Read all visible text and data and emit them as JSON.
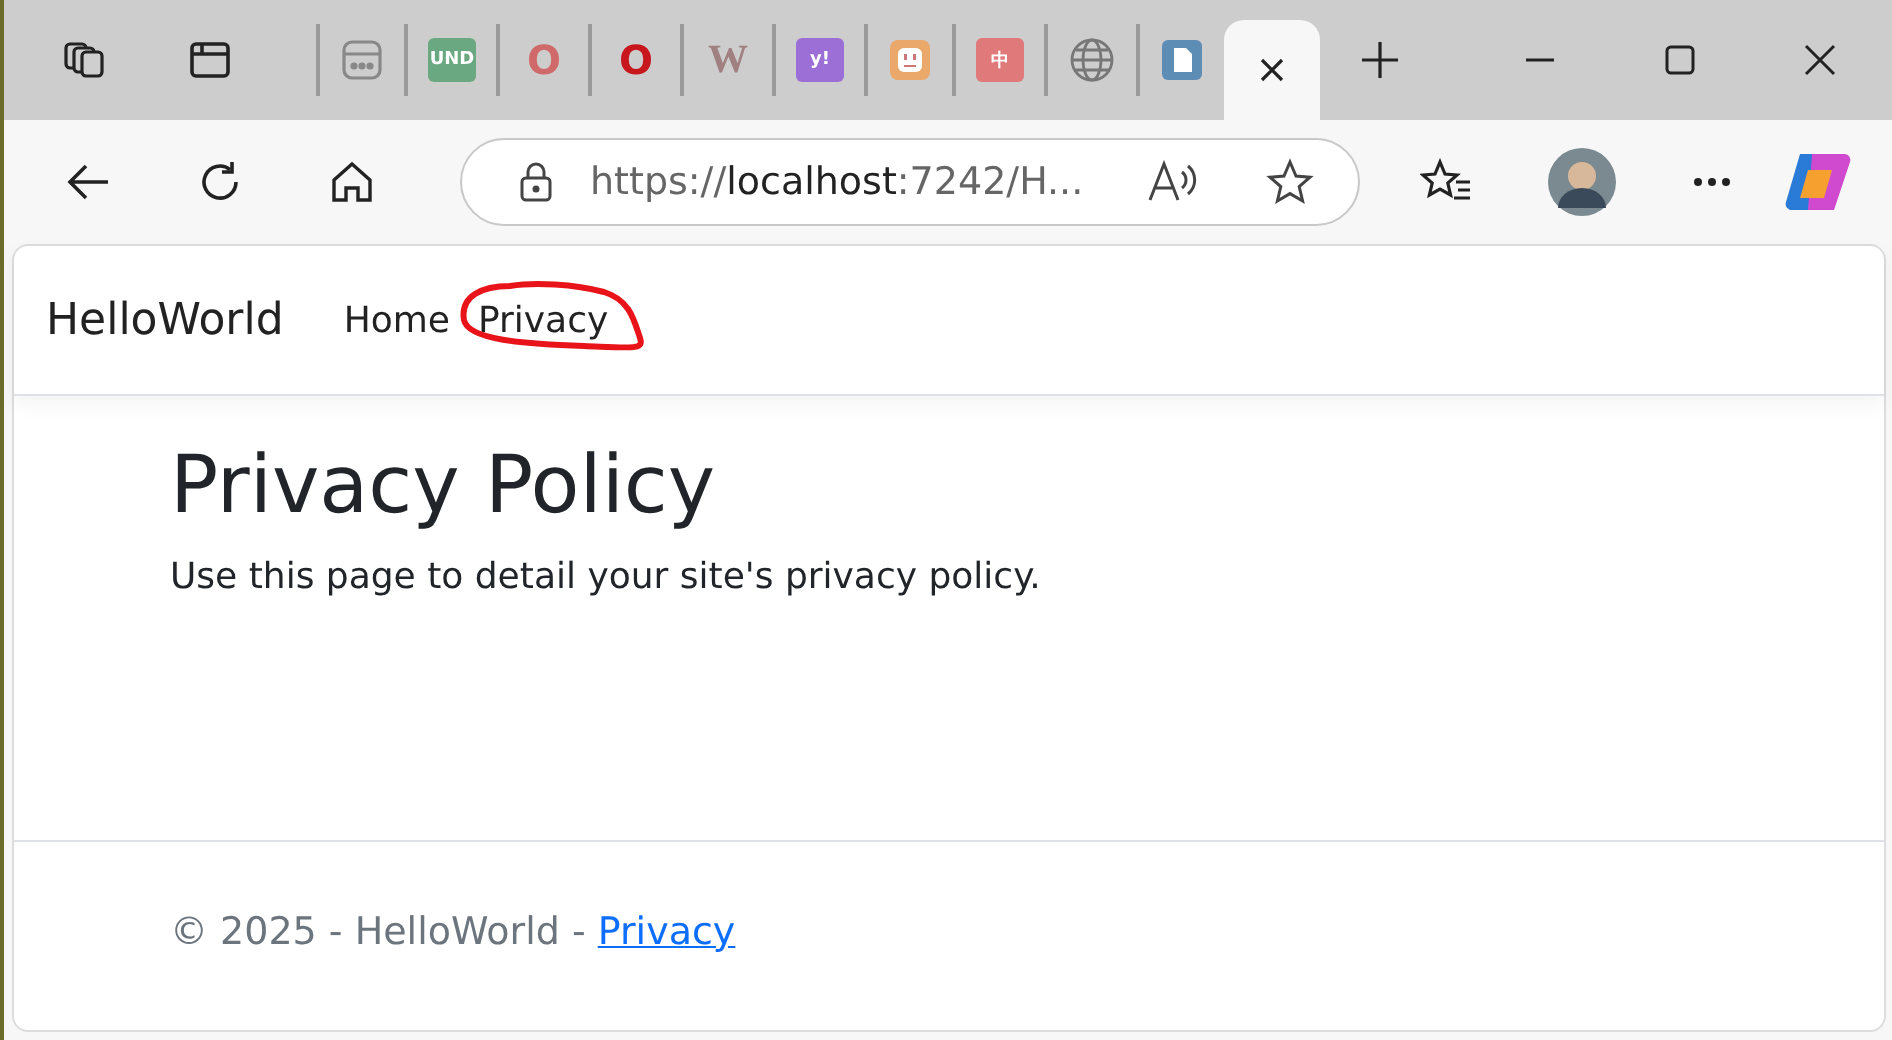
{
  "tabs": [
    {
      "kind": "grid",
      "selected": false
    },
    {
      "kind": "badge",
      "glyph": "UND",
      "color": "#6aa881",
      "selected": false
    },
    {
      "kind": "ring",
      "glyph": "O",
      "color": "#d06a6a",
      "selected": false
    },
    {
      "kind": "ring",
      "glyph": "O",
      "color": "#c8161d",
      "selected": false
    },
    {
      "kind": "letter",
      "glyph": "W",
      "color": "#a08080",
      "selected": false
    },
    {
      "kind": "badge",
      "glyph": "y!",
      "color": "#9b6fd6",
      "selected": false
    },
    {
      "kind": "plug",
      "color": "#eaa86a",
      "selected": false
    },
    {
      "kind": "badge",
      "glyph": "中",
      "color": "#e07a7a",
      "selected": false
    },
    {
      "kind": "globe",
      "selected": false
    },
    {
      "kind": "doc",
      "color": "#5d8db5",
      "selected": false
    },
    {
      "kind": "blank",
      "selected": true
    }
  ],
  "address": {
    "scheme": "https://",
    "host": "localhost",
    "rest": ":7242/H..."
  },
  "navbar": {
    "brand": "HelloWorld",
    "links": [
      {
        "label": "Home",
        "circled": false
      },
      {
        "label": "Privacy",
        "circled": true
      }
    ]
  },
  "heading": "Privacy Policy",
  "body": "Use this page to detail your site's privacy policy.",
  "footer": {
    "text": "© 2025 - HelloWorld - ",
    "link": "Privacy"
  }
}
